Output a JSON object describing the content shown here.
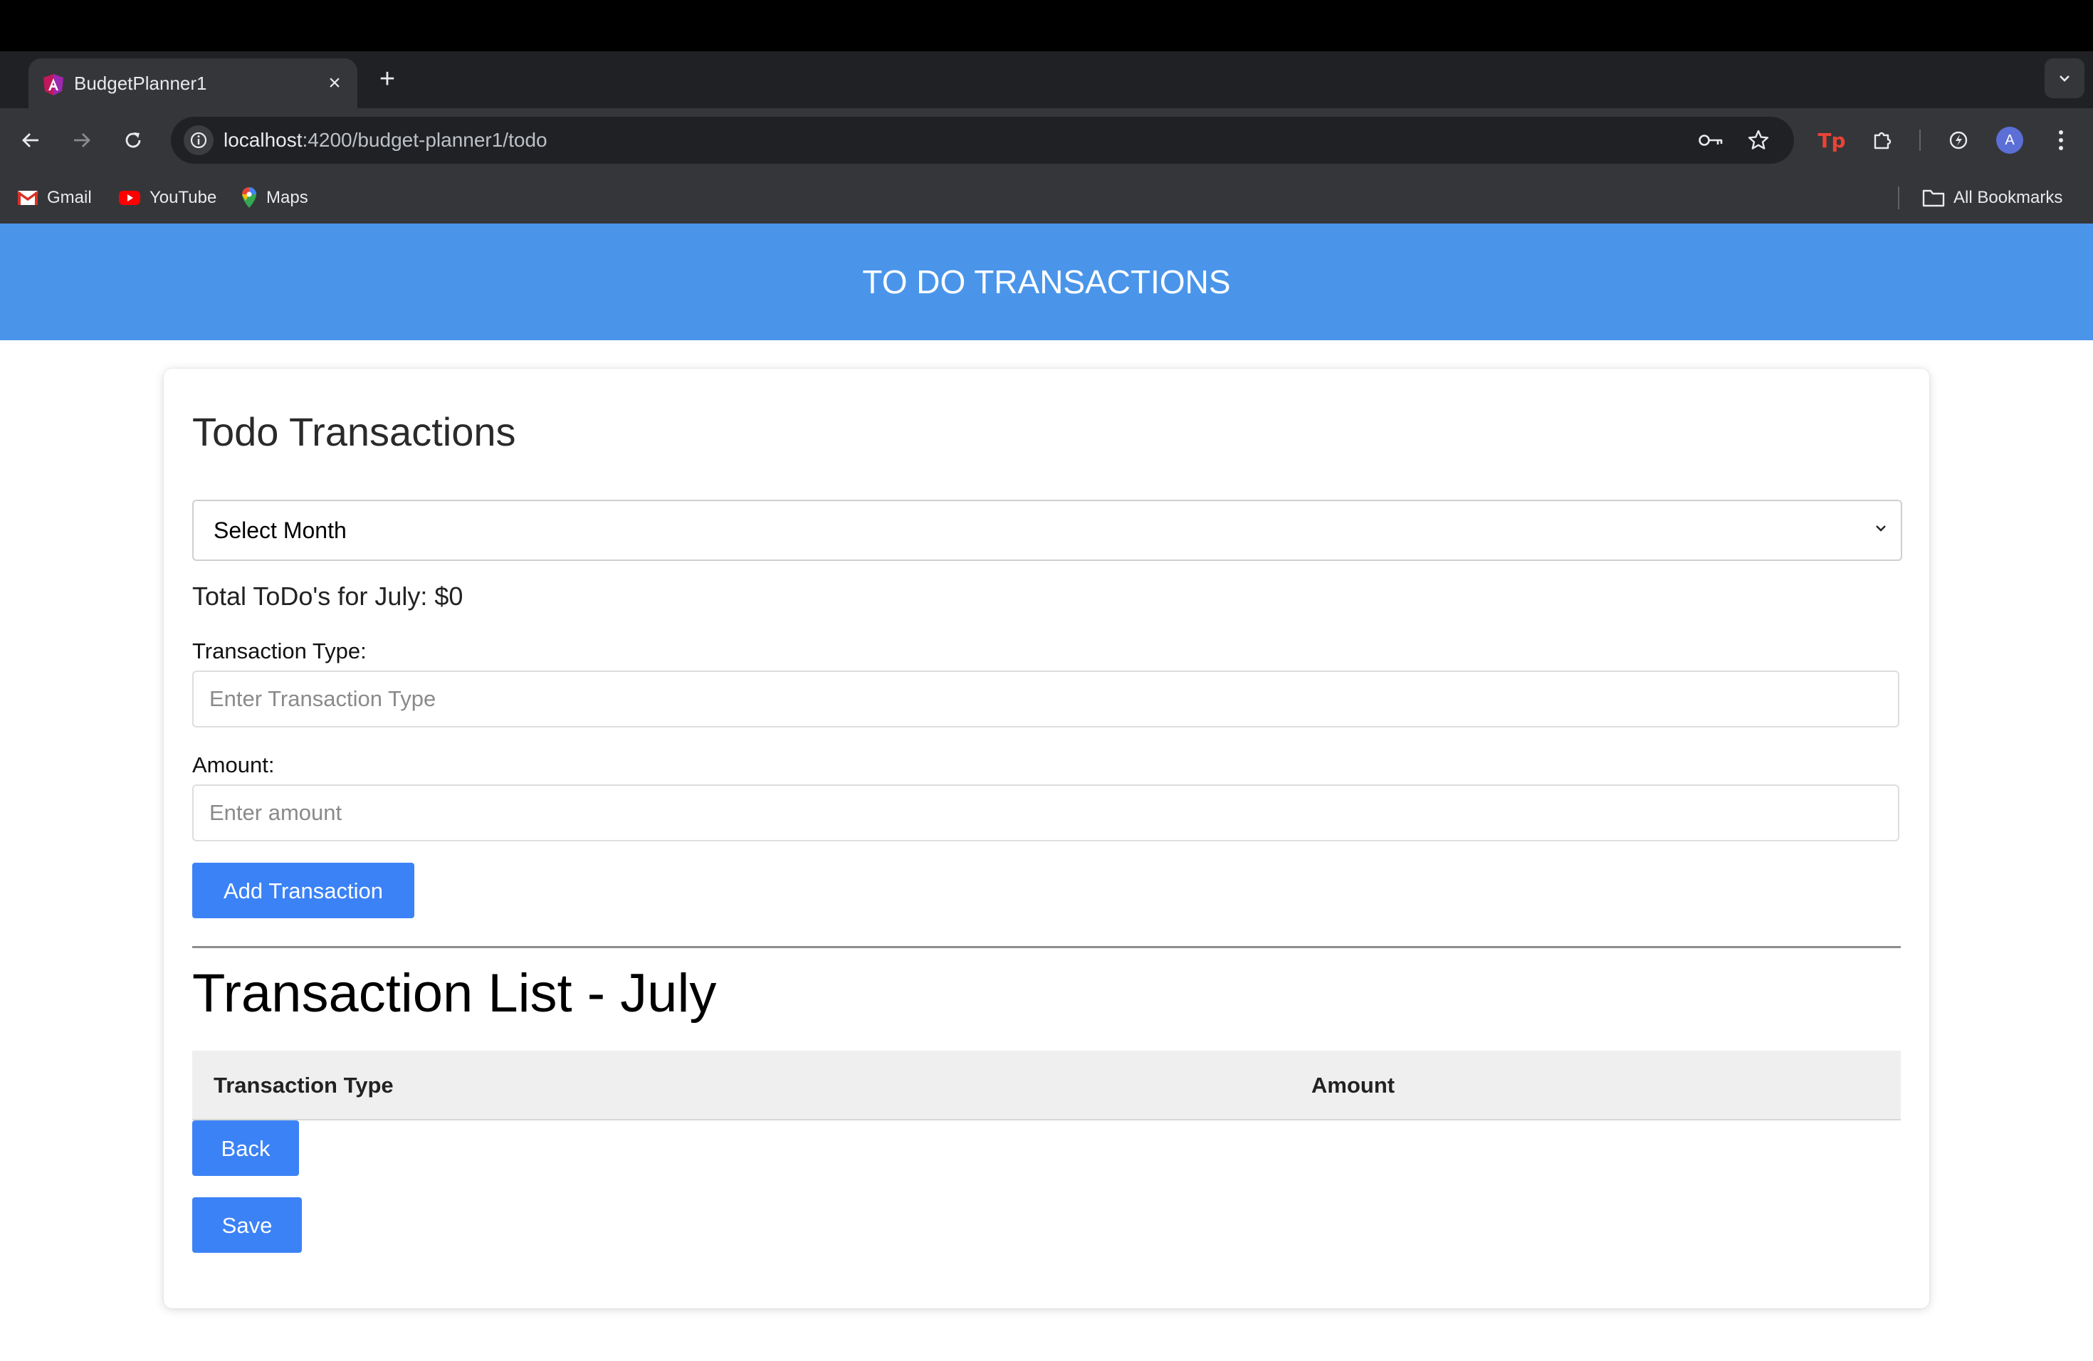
{
  "browser": {
    "tab": {
      "title": "BudgetPlanner1"
    },
    "url": {
      "host": "localhost",
      "path": ":4200/budget-planner1/todo"
    },
    "bookmarks": [
      {
        "label": "Gmail",
        "icon": "gmail-icon"
      },
      {
        "label": "YouTube",
        "icon": "youtube-icon"
      },
      {
        "label": "Maps",
        "icon": "maps-icon"
      }
    ],
    "all_bookmarks_label": "All Bookmarks",
    "profile_initial": "A",
    "extension_label": "Tp"
  },
  "header": {
    "title": "TO DO TRANSACTIONS"
  },
  "card": {
    "title": "Todo Transactions",
    "month_select": {
      "selected": "Select Month"
    },
    "total_text": "Total ToDo's for July: $0",
    "transaction_type": {
      "label": "Transaction Type:",
      "placeholder": "Enter Transaction Type",
      "value": ""
    },
    "amount": {
      "label": "Amount:",
      "placeholder": "Enter amount",
      "value": ""
    },
    "add_button": "Add Transaction",
    "list_title": "Transaction List - July",
    "table": {
      "columns": [
        "Transaction Type",
        "Amount"
      ],
      "rows": []
    },
    "back_button": "Back",
    "save_button": "Save"
  },
  "colors": {
    "header_bg": "#4a95ea",
    "button_bg": "#3b82f6",
    "chrome_dark": "#202124",
    "chrome_toolbar": "#35363a"
  }
}
